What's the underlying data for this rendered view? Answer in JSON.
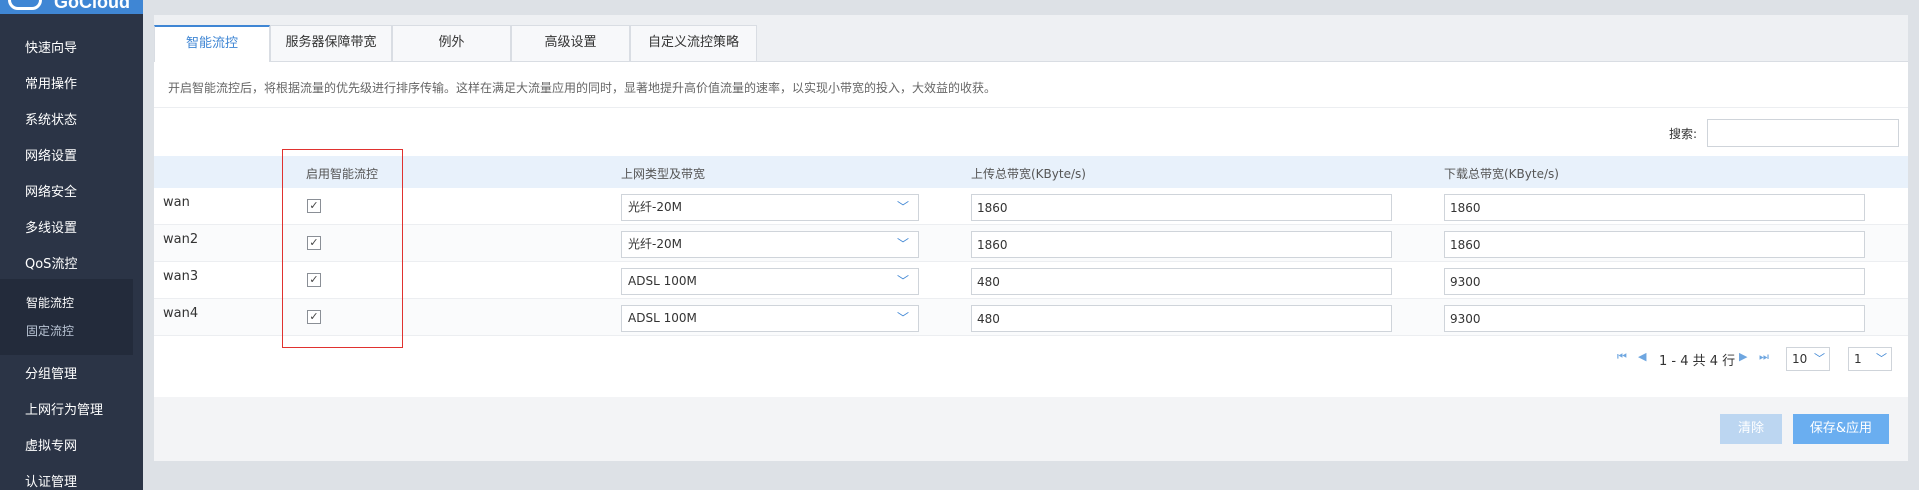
{
  "logo": {
    "text": "GoCloud"
  },
  "sidebar": {
    "items": [
      {
        "label": "快速向导"
      },
      {
        "label": "常用操作"
      },
      {
        "label": "系统状态"
      },
      {
        "label": "网络设置"
      },
      {
        "label": "网络安全"
      },
      {
        "label": "多线设置"
      },
      {
        "label": "QoS流控"
      },
      {
        "label": "分组管理"
      },
      {
        "label": "上网行为管理"
      },
      {
        "label": "虚拟专网"
      },
      {
        "label": "认证管理"
      }
    ],
    "subitems": [
      {
        "label": "智能流控"
      },
      {
        "label": "固定流控"
      }
    ]
  },
  "tabs": [
    {
      "label": "智能流控",
      "active": true
    },
    {
      "label": "服务器保障带宽"
    },
    {
      "label": "例外"
    },
    {
      "label": "高级设置"
    },
    {
      "label": "自定义流控策略"
    }
  ],
  "description": "开启智能流控后，将根据流量的优先级进行排序传输。这样在满足大流量应用的同时，显著地提升高价值流量的速率，以实现小带宽的投入，大效益的收获。",
  "search": {
    "label": "搜索:",
    "value": ""
  },
  "table": {
    "headers": [
      "启用智能流控",
      "上网类型及带宽",
      "上传总带宽(KByte/s)",
      "下载总带宽(KByte/s)"
    ],
    "rows": [
      {
        "name": "wan",
        "enabled": true,
        "type": "光纤-20M",
        "upload": "1860",
        "download": "1860"
      },
      {
        "name": "wan2",
        "enabled": true,
        "type": "光纤-20M",
        "upload": "1860",
        "download": "1860"
      },
      {
        "name": "wan3",
        "enabled": true,
        "type": "ADSL 100M",
        "upload": "480",
        "download": "9300"
      },
      {
        "name": "wan4",
        "enabled": true,
        "type": "ADSL 100M",
        "upload": "480",
        "download": "9300"
      }
    ]
  },
  "pager": {
    "range": "1 - 4 共 4 行",
    "page_size": "10",
    "page": "1"
  },
  "buttons": {
    "clear": "清除",
    "save": "保存&应用"
  },
  "icons": {
    "checkbox_checked": "✓",
    "chevron": "﹀",
    "first": "⏮",
    "prev": "◀",
    "next": "▶",
    "last": "⏭"
  },
  "colors": {
    "accent": "#3f86d4",
    "sidebar": "#2b3446",
    "highlight": "#e0322f"
  }
}
